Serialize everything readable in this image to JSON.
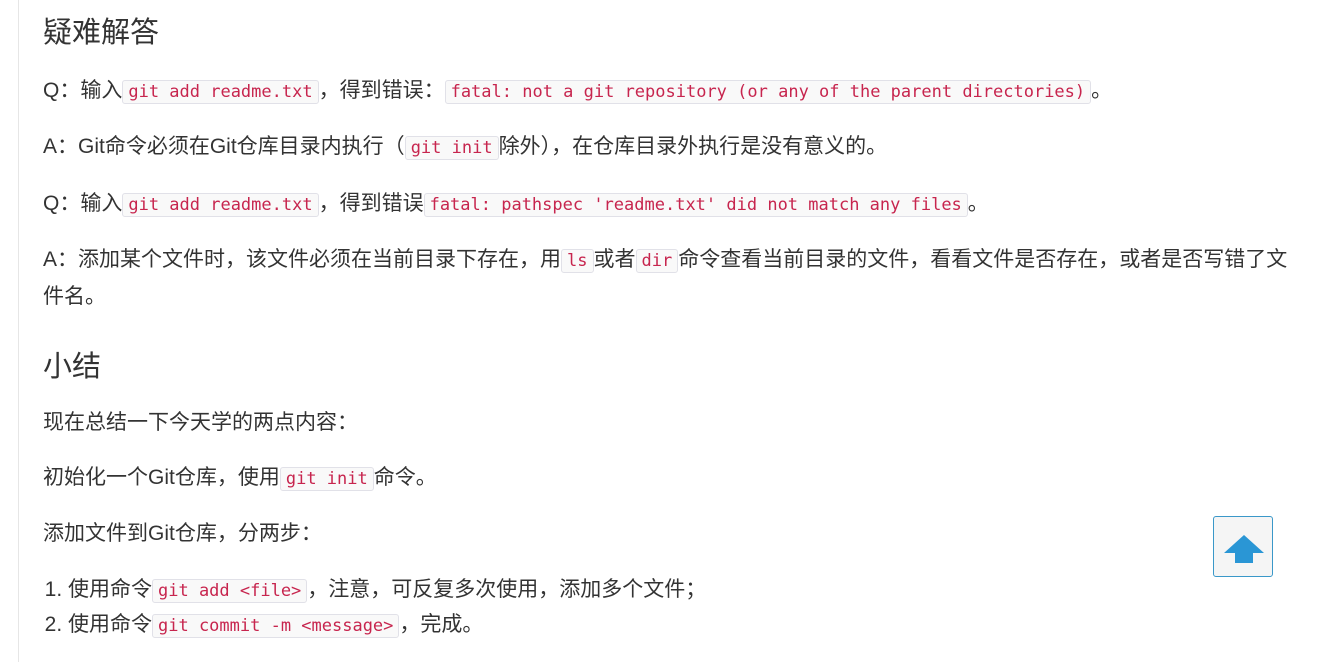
{
  "faq": {
    "heading": "疑难解答",
    "q1": {
      "prefix": "Q：输入",
      "code1": "git add readme.txt",
      "middle": "，得到错误：",
      "code2": "fatal: not a git repository (or any of the parent directories)",
      "suffix": "。"
    },
    "a1": {
      "prefix": "A：Git命令必须在Git仓库目录内执行（",
      "code1": "git init",
      "suffix": "除外），在仓库目录外执行是没有意义的。"
    },
    "q2": {
      "prefix": "Q：输入",
      "code1": "git add readme.txt",
      "middle": "，得到错误",
      "code2": "fatal: pathspec 'readme.txt' did not match any files",
      "suffix": "。"
    },
    "a2": {
      "prefix": "A：添加某个文件时，该文件必须在当前目录下存在，用",
      "code1": "ls",
      "middle": "或者",
      "code2": "dir",
      "suffix": "命令查看当前目录的文件，看看文件是否存在，或者是否写错了文件名。"
    }
  },
  "summary": {
    "heading": "小结",
    "intro": "现在总结一下今天学的两点内容：",
    "init": {
      "prefix": "初始化一个Git仓库，使用",
      "code1": "git init",
      "suffix": "命令。"
    },
    "add_intro": "添加文件到Git仓库，分两步：",
    "steps": [
      {
        "prefix": "使用命令",
        "code": "git add <file>",
        "suffix": "，注意，可反复多次使用，添加多个文件；"
      },
      {
        "prefix": "使用命令",
        "code": "git commit -m <message>",
        "suffix": "，完成。"
      }
    ]
  },
  "back_to_top": {
    "icon": "arrow-up-icon",
    "color": "#2a96d5"
  }
}
